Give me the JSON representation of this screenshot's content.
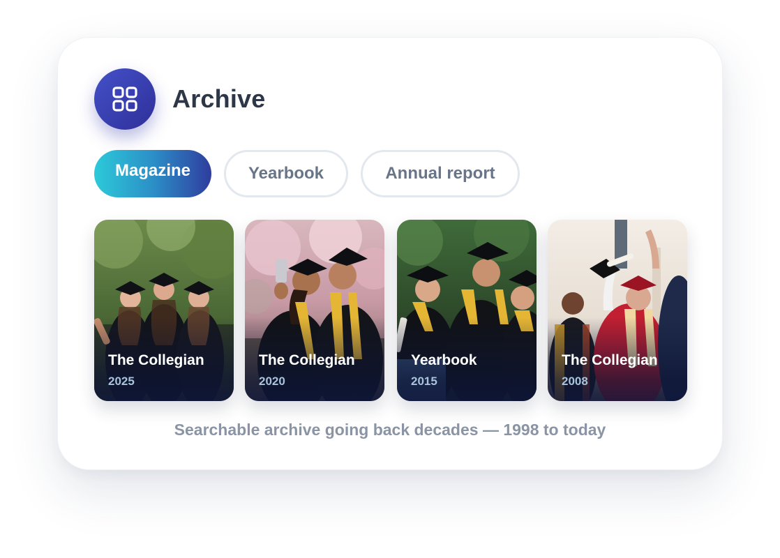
{
  "header": {
    "icon": "grid-icon",
    "title": "Archive"
  },
  "tabs": [
    {
      "label": "Magazine",
      "active": true
    },
    {
      "label": "Yearbook",
      "active": false
    },
    {
      "label": "Annual report",
      "active": false
    }
  ],
  "issues": [
    {
      "name": "The Collegian",
      "year": "2025"
    },
    {
      "name": "The Collegian",
      "year": "2020"
    },
    {
      "name": "Yearbook",
      "year": "2015"
    },
    {
      "name": "The Collegian",
      "year": "2008"
    }
  ],
  "footnote": "Searchable archive going back decades — 1998 to today",
  "colors": {
    "accent_gradient": [
      "#2ccad9",
      "#2f3d9e"
    ],
    "badge": "#3a43b4",
    "title_text": "#2d3747",
    "muted_text": "#8a94a5"
  }
}
